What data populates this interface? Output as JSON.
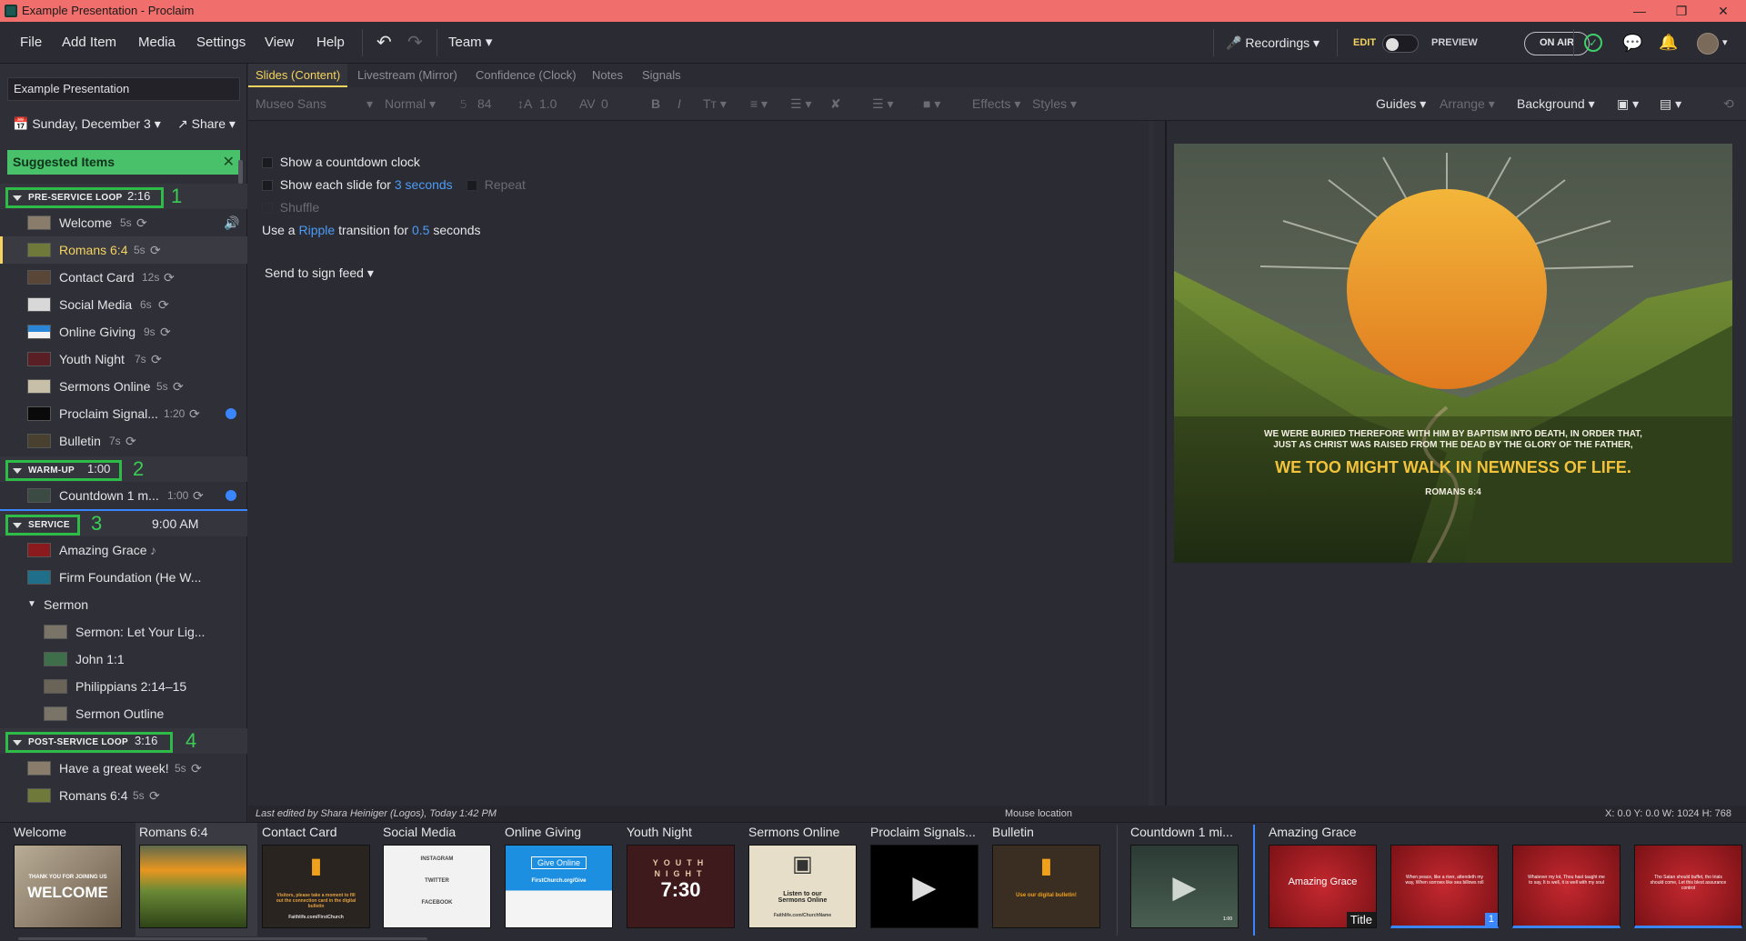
{
  "window": {
    "title": "Example Presentation - Proclaim"
  },
  "menubar": {
    "file": "File",
    "add_item": "Add Item",
    "media": "Media",
    "settings": "Settings",
    "view": "View",
    "help": "Help",
    "team": "Team",
    "recordings": "Recordings",
    "edit": "EDIT",
    "preview": "PREVIEW",
    "on_air": "ON AIR"
  },
  "sidebar": {
    "presentation_name": "Example Presentation",
    "date": "Sunday, December 3",
    "share": "Share",
    "suggested": "Suggested Items",
    "sections": [
      {
        "label": "PRE-SERVICE LOOP",
        "time": "2:16",
        "num": "1",
        "items": [
          {
            "name": "Welcome",
            "dur": "5s"
          },
          {
            "name": "Romans 6:4",
            "dur": "5s"
          },
          {
            "name": "Contact Card",
            "dur": "12s"
          },
          {
            "name": "Social Media",
            "dur": "6s"
          },
          {
            "name": "Online Giving",
            "dur": "9s"
          },
          {
            "name": "Youth Night",
            "dur": "7s"
          },
          {
            "name": "Sermons Online",
            "dur": "5s"
          },
          {
            "name": "Proclaim Signal...",
            "dur": "1:20"
          },
          {
            "name": "Bulletin",
            "dur": "7s"
          }
        ]
      },
      {
        "label": "WARM-UP",
        "time": "1:00",
        "num": "2",
        "items": [
          {
            "name": "Countdown 1 m...",
            "dur": "1:00"
          }
        ]
      },
      {
        "label": "SERVICE",
        "time": "9:00 AM",
        "num": "3",
        "items": [
          {
            "name": "Amazing Grace"
          },
          {
            "name": "Firm Foundation (He W..."
          },
          {
            "name": "Sermon"
          },
          {
            "name": "Sermon: Let Your Lig..."
          },
          {
            "name": "John 1:1"
          },
          {
            "name": "Philippians 2:14–15"
          },
          {
            "name": "Sermon Outline"
          }
        ]
      },
      {
        "label": "POST-SERVICE LOOP",
        "time": "3:16",
        "num": "4",
        "items": [
          {
            "name": "Have a great week!",
            "dur": "5s"
          },
          {
            "name": "Romans 6:4",
            "dur": "5s"
          }
        ]
      }
    ]
  },
  "tabs": [
    "Slides (Content)",
    "Livestream (Mirror)",
    "Confidence (Clock)",
    "Notes",
    "Signals"
  ],
  "toolbar": {
    "font": "Museo Sans",
    "weight": "Normal",
    "size": "84",
    "line": "1.0",
    "spacing": "0",
    "effects": "Effects",
    "styles": "Styles",
    "guides": "Guides",
    "arrange": "Arrange",
    "background": "Background"
  },
  "content": {
    "countdown": "Show a countdown clock",
    "each_slide_a": "Show each slide for",
    "each_slide_b": "3 seconds",
    "repeat": "Repeat",
    "shuffle": "Shuffle",
    "transition_a": "Use a",
    "transition_b": "Ripple",
    "transition_c": "transition for",
    "transition_d": "0.5",
    "transition_e": "seconds",
    "sign_feed": "Send to sign feed"
  },
  "preview": {
    "line1": "WE WERE BURIED THEREFORE WITH HIM BY BAPTISM INTO DEATH, IN ORDER THAT,",
    "line2": "JUST AS CHRIST WAS RAISED FROM THE DEAD BY THE GLORY OF THE FATHER,",
    "line3": "WE TOO MIGHT WALK IN NEWNESS OF LIFE.",
    "ref": "ROMANS 6:4"
  },
  "status": {
    "last_edited": "Last edited by Shara Heiniger (Logos), Today 1:42 PM",
    "mouse": "Mouse location",
    "coords": "X: 0.0  Y: 0.0     W: 1024  H: 768"
  },
  "filmstrip": [
    {
      "label": "Welcome",
      "text": "WELCOME",
      "sub": "THANK YOU FOR JOINING US"
    },
    {
      "label": "Romans 6:4"
    },
    {
      "label": "Contact Card",
      "text": "Visitors, please take a moment to fill out the connection card in the digital bulletin",
      "sub": "Faithlife.com/FirstChurch"
    },
    {
      "label": "Social Media",
      "text": "INSTAGRAM",
      "t2": "TWITTER",
      "t3": "FACEBOOK"
    },
    {
      "label": "Online Giving",
      "text": "Give Online",
      "sub": "FirstChurch.org/Give"
    },
    {
      "label": "Youth Night",
      "text": "YOUTH",
      "t2": "NIGHT",
      "t3": "7:30"
    },
    {
      "label": "Sermons Online",
      "text": "Listen to our Sermons Online",
      "sub": "Faithlife.com/ChurchName"
    },
    {
      "label": "Proclaim Signals..."
    },
    {
      "label": "Bulletin",
      "text": "Use our digital bulletin!"
    },
    {
      "label": "Countdown 1 mi...",
      "sub": "1:00"
    },
    {
      "label": "Amazing Grace",
      "text": "Amazing Grace",
      "tag": "Title"
    },
    {
      "label": "",
      "text": "When peace, like a river, attendeth my way, When sorrows like sea billows roll",
      "tag": "1"
    },
    {
      "label": "",
      "text": "Whatever my lot, Thou hast taught me to say, It is well, it is well with my soul"
    },
    {
      "label": "",
      "text": "Tho Satan should buffet, tho trials should come, Let this blest assurance control"
    }
  ]
}
